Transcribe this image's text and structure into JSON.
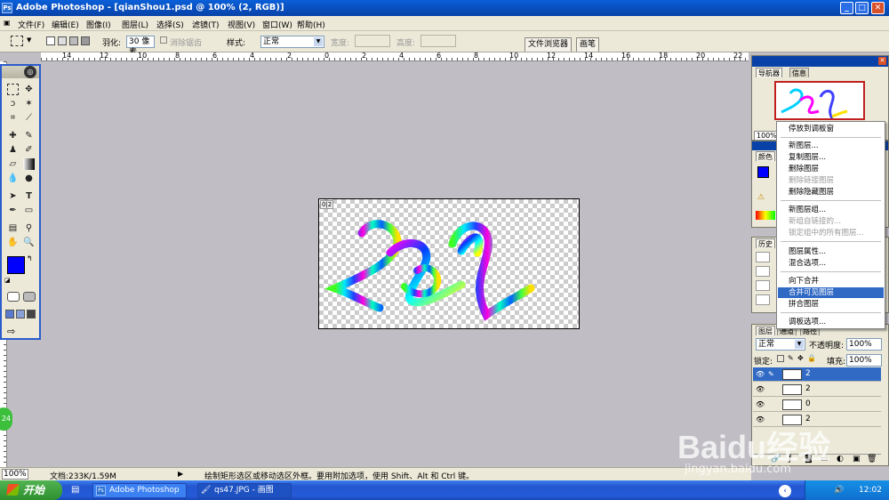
{
  "app": {
    "title": "Adobe Photoshop - [qianShou1.psd @ 100% (2, RGB)]",
    "logo": "Ps"
  },
  "window_buttons": {
    "minimize": "_",
    "restore": "□",
    "close": "✕"
  },
  "menubar": [
    "文件(F)",
    "编辑(E)",
    "图像(I)",
    "图层(L)",
    "选择(S)",
    "滤镜(T)",
    "视图(V)",
    "窗口(W)",
    "帮助(H)"
  ],
  "options": {
    "feather_label": "羽化:",
    "feather_value": "30 像素",
    "antialias_label": "消除锯齿",
    "style_label": "样式:",
    "style_value": "正常",
    "width_label": "宽度:",
    "height_label": "高度:",
    "tab_browser": "文件浏览器",
    "tab_brush": "画笔"
  },
  "ruler_labels": [
    "14",
    "12",
    "10",
    "8",
    "6",
    "4",
    "2",
    "0",
    "2",
    "4",
    "6",
    "8",
    "10",
    "12",
    "14",
    "16",
    "18",
    "20",
    "22"
  ],
  "document": {
    "tag": "0|2"
  },
  "panels": {
    "navigator_tab": "导航器",
    "info_tab": "信息",
    "zoom": "100%",
    "color_tab": "颜色",
    "history_tab": "历史",
    "layers_tabs": [
      "图层",
      "通道",
      "路径"
    ],
    "blend_mode": "正常",
    "opacity_label": "不透明度:",
    "opacity_value": "100%",
    "lock_label": "锁定:",
    "fill_label": "填充:",
    "fill_value": "100%"
  },
  "context_menu": [
    {
      "label": "停放到调板窗",
      "disabled": false,
      "highlight": false
    },
    {
      "label": "新图层...",
      "disabled": false,
      "highlight": false
    },
    {
      "label": "复制图层...",
      "disabled": false,
      "highlight": false
    },
    {
      "label": "删除图层",
      "disabled": false,
      "highlight": false
    },
    {
      "label": "删除链接图层",
      "disabled": true,
      "highlight": false
    },
    {
      "label": "删除隐藏图层",
      "disabled": false,
      "highlight": false
    },
    {
      "label": "新图层组...",
      "disabled": false,
      "highlight": false
    },
    {
      "label": "新组自链接的...",
      "disabled": true,
      "highlight": false
    },
    {
      "label": "锁定组中的所有图层...",
      "disabled": true,
      "highlight": false
    },
    {
      "label": "图层属性...",
      "disabled": false,
      "highlight": false
    },
    {
      "label": "混合选项...",
      "disabled": false,
      "highlight": false
    },
    {
      "label": "向下合并",
      "disabled": false,
      "highlight": false
    },
    {
      "label": "合并可见图层",
      "disabled": false,
      "highlight": true
    },
    {
      "label": "拼合图层",
      "disabled": false,
      "highlight": false
    },
    {
      "label": "调板选项...",
      "disabled": false,
      "highlight": false
    }
  ],
  "layers": [
    {
      "name": "2",
      "selected": true
    },
    {
      "name": "2",
      "selected": false
    },
    {
      "name": "0",
      "selected": false
    },
    {
      "name": "2",
      "selected": false
    }
  ],
  "status": {
    "zoom": "100%",
    "doc": "文档:233K/1.59M",
    "hint": "绘制矩形选区或移动选区外框。要用附加选项，使用 Shift、Alt 和 Ctrl 键。"
  },
  "taskbar": {
    "start": "开始",
    "items": [
      "Adobe Photoshop ...",
      "qs47.JPG - 画图"
    ],
    "clock": "12:02"
  },
  "watermark": {
    "brand": "Baidu经验",
    "url": "jingyan.baidu.com"
  },
  "colors": {
    "title_bar": "#0842a8",
    "selection": "#316ac5",
    "foreground": "#0000ff"
  }
}
